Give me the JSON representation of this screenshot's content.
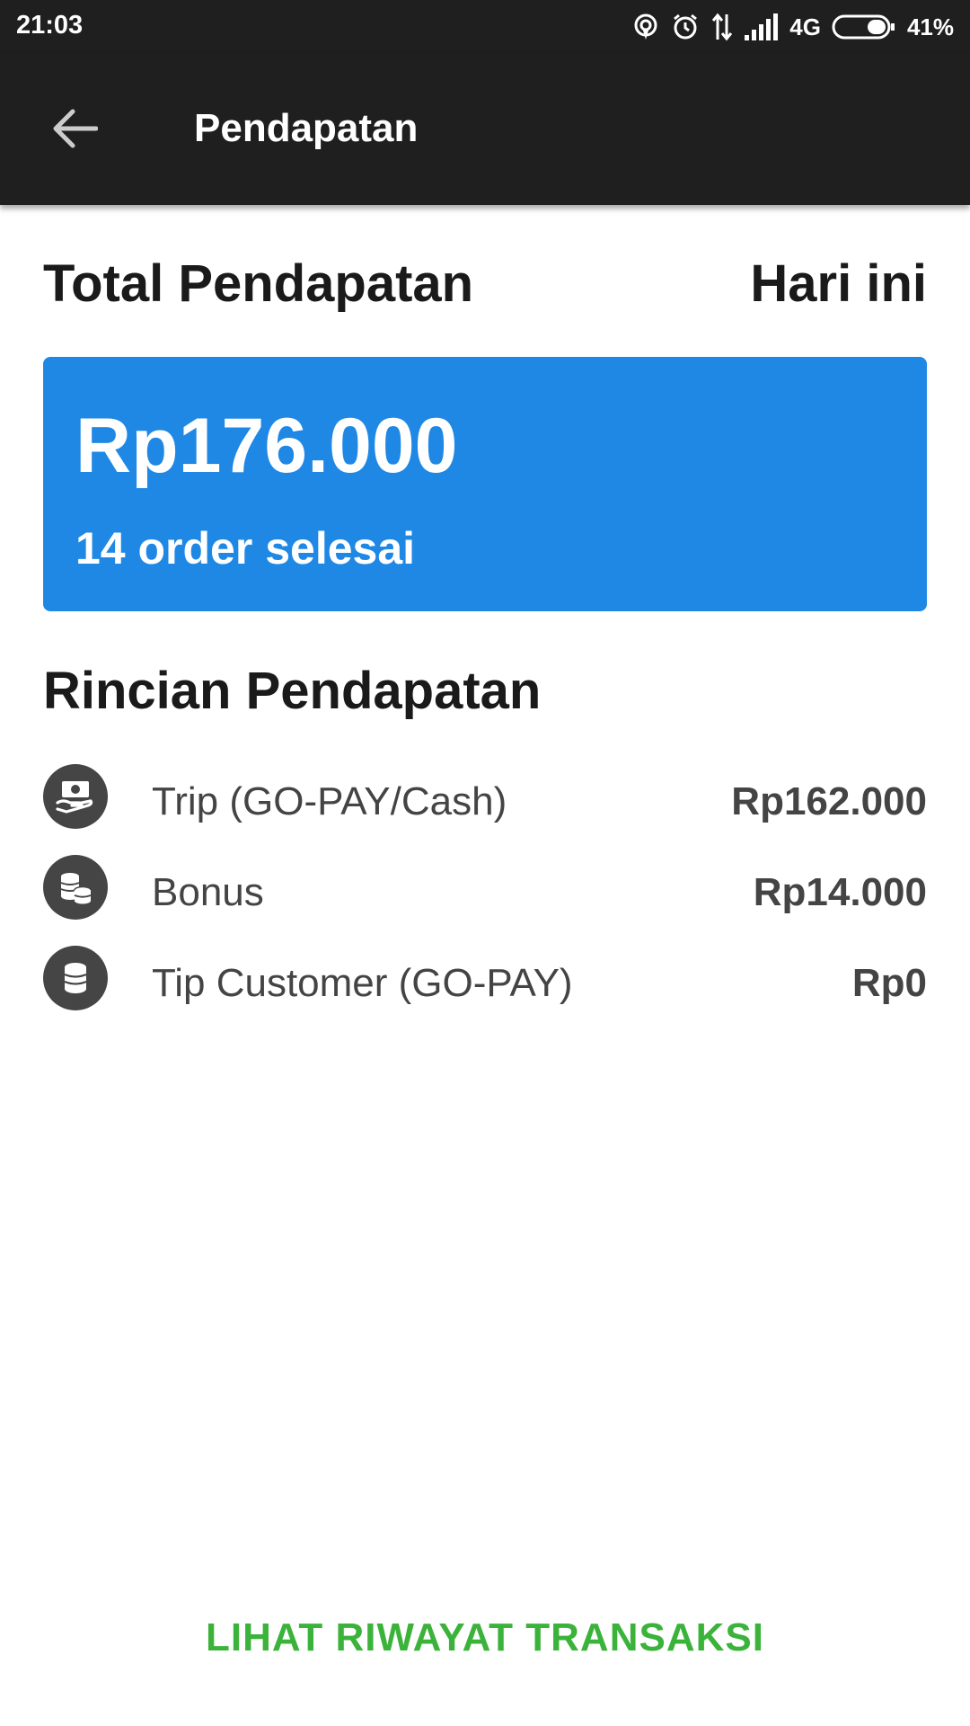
{
  "status_bar": {
    "time": "21:03",
    "network": "4G",
    "battery": "41%",
    "icons": [
      "hotspot-icon",
      "alarm-icon",
      "data-transfer-icon",
      "signal-icon",
      "battery-icon"
    ]
  },
  "app_bar": {
    "title": "Pendapatan",
    "back_icon": "arrow-left-icon",
    "background": "#1f1f1f"
  },
  "summary": {
    "label": "Total Pendapatan",
    "period": "Hari ini",
    "amount": "Rp176.000",
    "orders": "14 order selesai",
    "card_color": "#1f88e5"
  },
  "breakdown": {
    "title": "Rincian Pendapatan",
    "items": [
      {
        "icon": "cash-hand-icon",
        "label": "Trip (GO-PAY/Cash)",
        "value": "Rp162.000"
      },
      {
        "icon": "coins-stack-icon",
        "label": "Bonus",
        "value": "Rp14.000"
      },
      {
        "icon": "coin-stack-icon",
        "label": "Tip Customer (GO-PAY)",
        "value": "Rp0"
      }
    ]
  },
  "footer": {
    "history_link": "LIHAT RIWAYAT TRANSAKSI",
    "link_color": "#3bb33b"
  }
}
